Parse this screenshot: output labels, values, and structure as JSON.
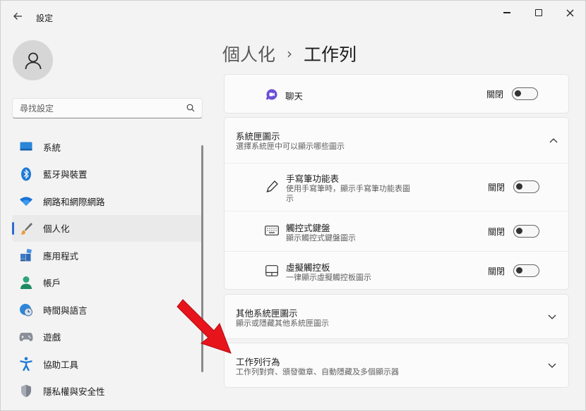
{
  "window": {
    "title": "設定"
  },
  "sidebar": {
    "search_placeholder": "尋找設定",
    "items": [
      {
        "label": "系統",
        "icon": "system-icon"
      },
      {
        "label": "藍牙與裝置",
        "icon": "bluetooth-icon"
      },
      {
        "label": "網路和網際網路",
        "icon": "wifi-icon"
      },
      {
        "label": "個人化",
        "icon": "brush-icon",
        "active": true
      },
      {
        "label": "應用程式",
        "icon": "apps-icon"
      },
      {
        "label": "帳戶",
        "icon": "account-icon"
      },
      {
        "label": "時間與語言",
        "icon": "clock-globe-icon"
      },
      {
        "label": "遊戲",
        "icon": "gamepad-icon"
      },
      {
        "label": "協助工具",
        "icon": "accessibility-icon"
      },
      {
        "label": "隱私權與安全性",
        "icon": "shield-icon"
      }
    ]
  },
  "breadcrumb": {
    "parent": "個人化",
    "separator": "›",
    "current": "工作列"
  },
  "chat": {
    "label": "聊天",
    "toggle_text": "關閉",
    "toggle_on": false
  },
  "tray_icons": {
    "title": "系統匣圖示",
    "subtitle": "選擇系統匣中可以顯示哪些圖示",
    "items": [
      {
        "title": "手寫筆功能表",
        "subtitle_line1": "使用手寫筆時，顯示手寫筆功能表圖",
        "subtitle_line2": "示",
        "toggle_text": "關閉",
        "icon": "pen-icon"
      },
      {
        "title": "觸控式鍵盤",
        "subtitle_line1": "顯示觸控式鍵盤圖示",
        "subtitle_line2": "",
        "toggle_text": "關閉",
        "icon": "keyboard-icon"
      },
      {
        "title": "虛擬觸控板",
        "subtitle_line1": "一律顯示虛擬觸控板圖示",
        "subtitle_line2": "",
        "toggle_text": "關閉",
        "icon": "touchpad-icon"
      }
    ]
  },
  "other_tray": {
    "title": "其他系統匣圖示",
    "subtitle": "顯示或隱藏其他系統匣圖示"
  },
  "taskbar_behaviors": {
    "title": "工作列行為",
    "subtitle": "工作列對齊、頒發徽章、自動隱藏及多個顯示器"
  },
  "colors": {
    "accent": "#2d6bd3",
    "arrow": "#e8141b"
  }
}
